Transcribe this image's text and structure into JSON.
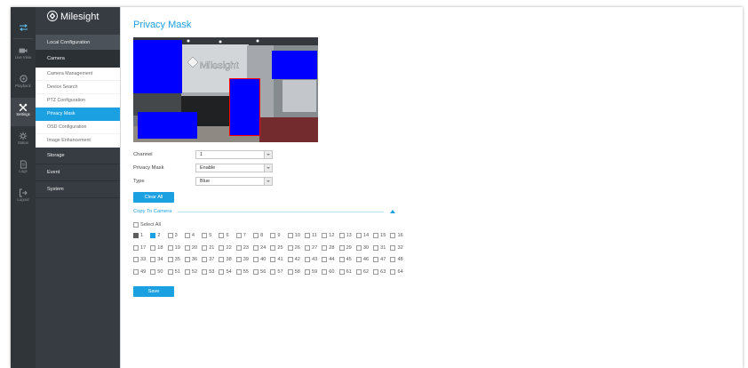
{
  "app": {
    "brand": "Milesight",
    "brand_icon": "milesight-logo-icon"
  },
  "icon_nav": {
    "toggle_icon": "swap-arrows-icon",
    "items": [
      {
        "label": "Live View",
        "icon": "live-view-icon",
        "active": false
      },
      {
        "label": "Playback",
        "icon": "playback-icon",
        "active": false
      },
      {
        "label": "Settings",
        "icon": "settings-tools-icon",
        "active": true
      },
      {
        "label": "Status",
        "icon": "status-icon",
        "active": false
      },
      {
        "label": "Logs",
        "icon": "logs-icon",
        "active": false
      },
      {
        "label": "Logout",
        "icon": "logout-icon",
        "active": false
      }
    ]
  },
  "menu": {
    "local_configuration": "Local Configuration",
    "camera": {
      "label": "Camera",
      "items": [
        {
          "label": "Camera Management",
          "active": false
        },
        {
          "label": "Device Search",
          "active": false
        },
        {
          "label": "PTZ Configuration",
          "active": false
        },
        {
          "label": "Privacy Mask",
          "active": true
        },
        {
          "label": "OSD Configuration",
          "active": false
        },
        {
          "label": "Image Enhancement",
          "active": false
        }
      ]
    },
    "sections": [
      {
        "label": "Storage"
      },
      {
        "label": "Event"
      },
      {
        "label": "System"
      }
    ]
  },
  "page": {
    "title": "Privacy Mask",
    "preview": {
      "wall_logo_text": "Milesight",
      "mask_color": "#0000ff",
      "selected_outline_color": "#ff0000"
    },
    "form": {
      "channel": {
        "label": "Channel",
        "value": "1"
      },
      "privacy_mask": {
        "label": "Privacy Mask",
        "value": "Enable"
      },
      "type": {
        "label": "Type",
        "value": "Blue"
      }
    },
    "buttons": {
      "clear_all": "Clear All",
      "save": "Save"
    },
    "copy_to_camera": {
      "label": "Copy To Camera",
      "collapse_icon": "triangle-up-icon",
      "select_all": "Select All",
      "select_all_checked": false,
      "channels": [
        {
          "label": "1",
          "checked": true,
          "disabled": true
        },
        {
          "label": "2",
          "checked": true
        },
        {
          "label": "3"
        },
        {
          "label": "4"
        },
        {
          "label": "5"
        },
        {
          "label": "6"
        },
        {
          "label": "7"
        },
        {
          "label": "8"
        },
        {
          "label": "9"
        },
        {
          "label": "10"
        },
        {
          "label": "11"
        },
        {
          "label": "12"
        },
        {
          "label": "13"
        },
        {
          "label": "14"
        },
        {
          "label": "15"
        },
        {
          "label": "16"
        },
        {
          "label": "17"
        },
        {
          "label": "18"
        },
        {
          "label": "19"
        },
        {
          "label": "20"
        },
        {
          "label": "21"
        },
        {
          "label": "22"
        },
        {
          "label": "23"
        },
        {
          "label": "24"
        },
        {
          "label": "25"
        },
        {
          "label": "26"
        },
        {
          "label": "27"
        },
        {
          "label": "28"
        },
        {
          "label": "29"
        },
        {
          "label": "30"
        },
        {
          "label": "31"
        },
        {
          "label": "32"
        },
        {
          "label": "33"
        },
        {
          "label": "34"
        },
        {
          "label": "35"
        },
        {
          "label": "36"
        },
        {
          "label": "37"
        },
        {
          "label": "38"
        },
        {
          "label": "39"
        },
        {
          "label": "40"
        },
        {
          "label": "41"
        },
        {
          "label": "42"
        },
        {
          "label": "43"
        },
        {
          "label": "44"
        },
        {
          "label": "45"
        },
        {
          "label": "46"
        },
        {
          "label": "47"
        },
        {
          "label": "48"
        },
        {
          "label": "49"
        },
        {
          "label": "50"
        },
        {
          "label": "51"
        },
        {
          "label": "52"
        },
        {
          "label": "53"
        },
        {
          "label": "54"
        },
        {
          "label": "55"
        },
        {
          "label": "56"
        },
        {
          "label": "57"
        },
        {
          "label": "58"
        },
        {
          "label": "59"
        },
        {
          "label": "60"
        },
        {
          "label": "61"
        },
        {
          "label": "62"
        },
        {
          "label": "63"
        },
        {
          "label": "64"
        }
      ]
    }
  },
  "colors": {
    "accent": "#1ba1e2",
    "icon_bar_bg": "#30353a",
    "menu_bg": "#363c42"
  }
}
